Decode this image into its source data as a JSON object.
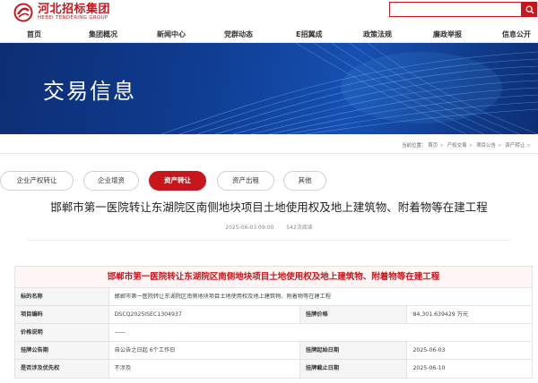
{
  "brand": {
    "name_cn": "河北招标集团",
    "name_en": "HEBEI TENDERING GROUP",
    "color": "#c8161d"
  },
  "search": {
    "placeholder": ""
  },
  "nav": [
    {
      "label": "首页"
    },
    {
      "label": "集团概况"
    },
    {
      "label": "新闻中心"
    },
    {
      "label": "党群动态"
    },
    {
      "label": "E招翼成"
    },
    {
      "label": "政策法规"
    },
    {
      "label": "廉政举报"
    },
    {
      "label": "信息公开"
    }
  ],
  "banner": {
    "title": "交易信息"
  },
  "breadcrumb": {
    "prefix": "当前位置：",
    "items": [
      "首页",
      "产权交易",
      "项目公告",
      "资产转让"
    ]
  },
  "tabs": [
    {
      "label": "企业产权转让",
      "active": false
    },
    {
      "label": "企业增资",
      "active": false
    },
    {
      "label": "资产转让",
      "active": true
    },
    {
      "label": "资产出租",
      "active": false
    },
    {
      "label": "其他",
      "active": false
    }
  ],
  "article": {
    "title": "邯郸市第一医院转让东湖院区南侧地块项目土地使用权及地上建筑物、附着物等在建工程",
    "date": "2025-06-03 09:00",
    "views": "542次阅读"
  },
  "info": {
    "header": "邯郸市第一医院转让东湖院区南侧地块项目土地使用权及地上建筑物、附着物等在建工程",
    "rows": {
      "name_label": "标的名称",
      "name_value": "邯郸市第一医院转让东湖院区南侧地块项目土地使用权及地上建筑物、附着物等在建工程",
      "code_label": "项目编码",
      "code_value": "DSCQ2025ISEC1304937",
      "price_label": "挂牌价格",
      "price_value": "84,301.639429 万元",
      "price_note_label": "价格说明",
      "price_note_value": "——",
      "period_label": "挂牌公告期",
      "period_value": "自公告之日起 6个工作日",
      "start_label": "挂牌起始日期",
      "start_value": "2025-06-03",
      "priority_label": "是否涉及优先权",
      "priority_value": "不涉及",
      "end_label": "挂牌截止日期",
      "end_value": "2025-06-10"
    }
  }
}
